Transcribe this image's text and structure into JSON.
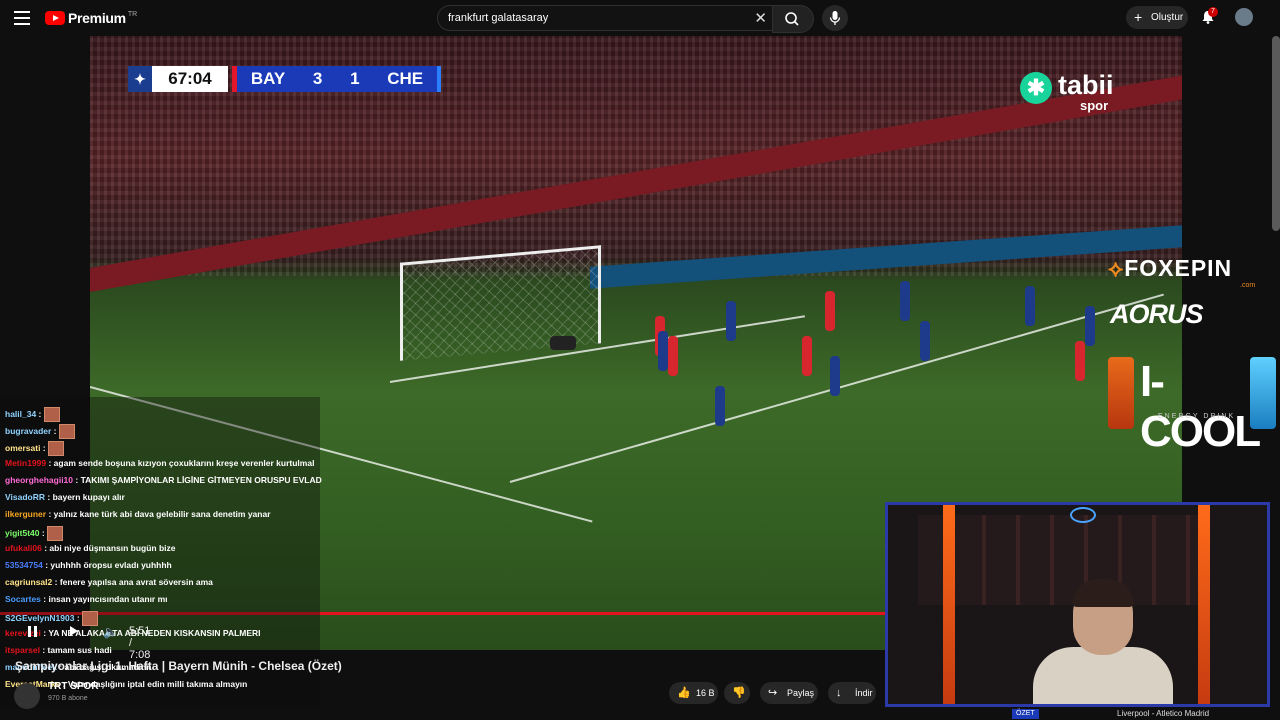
{
  "header": {
    "logo_text": "Premium",
    "logo_region": "TR",
    "search_value": "frankfurt galatasaray",
    "create_label": "Oluştur",
    "notification_count": "7"
  },
  "scorebug": {
    "clock": "67:04",
    "home_team": "BAY",
    "home_score": "3",
    "away_score": "1",
    "away_team": "CHE"
  },
  "broadcaster": {
    "name": "tabii",
    "sub": "spor"
  },
  "sponsors": {
    "foxepin": "FOXEPIN",
    "foxepin_domain": ".com",
    "aorus": "AORUS",
    "icool": "I-COOL",
    "icool_sub": "ENERGY DRINK"
  },
  "chat": [
    {
      "user": "halil_34",
      "msg": "",
      "emote": true,
      "color": "#8fd3ff"
    },
    {
      "user": "bugravader",
      "msg": "",
      "emote": true,
      "color": "#8fd3ff"
    },
    {
      "user": "omersati",
      "msg": "",
      "emote": true,
      "color": "#ffe48a"
    },
    {
      "user": "Metin1999",
      "msg": "agam sende boşuna kızıyon çoxuklarını kreşe verenler kurtulmal",
      "emote": false,
      "color": "#e4131d"
    },
    {
      "user": "gheorghehagii10",
      "msg": "TAKIMI ŞAMPİYONLAR LİGİNE GİTMEYEN ORUSPU EVLAD",
      "emote": false,
      "color": "#ff6bd6"
    },
    {
      "user": "VisadoRR",
      "msg": "bayern kupayı alır",
      "emote": false,
      "color": "#8fd3ff"
    },
    {
      "user": "ilkerguner",
      "msg": "yalnız kane türk abi dava gelebilir sana denetim yanar",
      "emote": false,
      "color": "#f5a623"
    },
    {
      "user": "yigit5t40",
      "msg": "",
      "emote": true,
      "color": "#7cff6b"
    },
    {
      "user": "ufukali06",
      "msg": "abi niye düşmansın bugün bize",
      "emote": false,
      "color": "#e4131d"
    },
    {
      "user": "53534754",
      "msg": "yuhhhh öropsu evladı yuhhhh",
      "emote": false,
      "color": "#4a7dff"
    },
    {
      "user": "cagriunsal2",
      "msg": "fenere yapılsa ana avrat söversin ama",
      "emote": false,
      "color": "#ffe48a"
    },
    {
      "user": "Socartes",
      "msg": "insan yayıncısından utanır mı",
      "emote": false,
      "color": "#4a9dff"
    },
    {
      "user": "S2GEvelynN1903",
      "msg": "",
      "emote": true,
      "color": "#8fd3ff"
    },
    {
      "user": "kerevizei",
      "msg": "YA NE ALAKA ATA ABİ NEDEN KISKANSIN PALMERI",
      "emote": false,
      "color": "#e4131d"
    },
    {
      "user": "itsparsel",
      "msg": "tamam sus hadi",
      "emote": false,
      "color": "#e4131d"
    },
    {
      "user": "mamionfleek",
      "msg": "abi bağışı okumadınn",
      "emote": false,
      "color": "#8fd3ff"
    },
    {
      "user": "EverestMarks",
      "msg": "Vatandaşlığını iptal edin milli takıma almayın",
      "emote": false,
      "color": "#ffe48a"
    }
  ],
  "player": {
    "progress": 0.82,
    "time_display": "5:51 / 7:08"
  },
  "video": {
    "title": "Şampiyonlar Ligi 1. Hafta | Bayern Münih - Chelsea (Özet)",
    "channel": "TRT SPOR",
    "subscribers": "970 B abone"
  },
  "actions": {
    "likes": "16 B",
    "share": "Paylaş",
    "download": "İndir"
  },
  "up_next": {
    "tag": "ÖZET",
    "title": "Liverpool - Atletico Madrid"
  }
}
